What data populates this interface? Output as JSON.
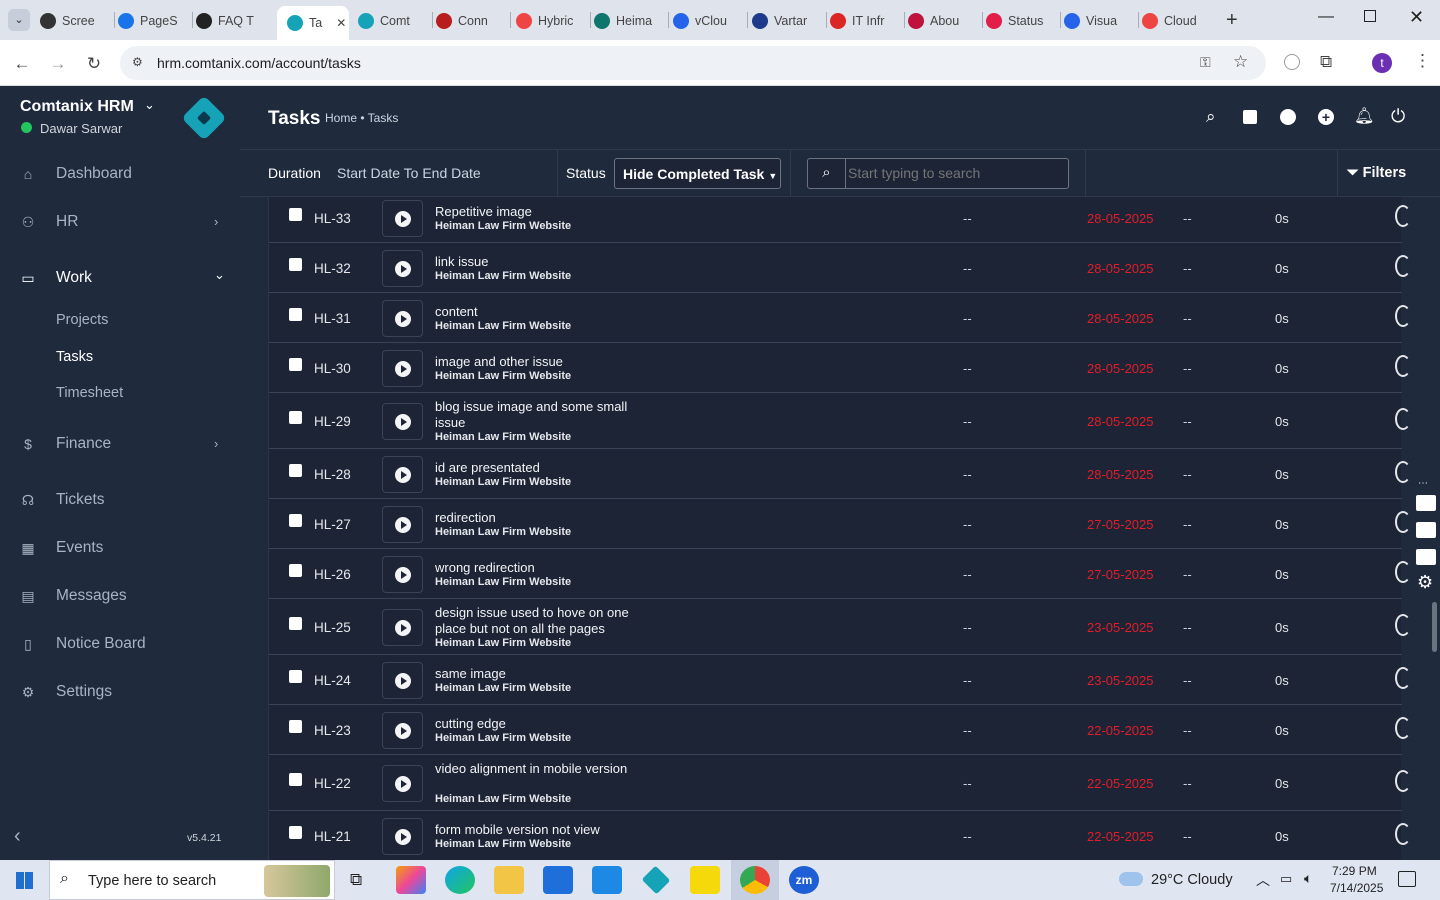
{
  "browser": {
    "tabs": [
      "Scree",
      "PageS",
      "FAQ T",
      "Ta",
      "Comt",
      "Conn",
      "Hybric",
      "Heima",
      "vClou",
      "Vartar",
      "IT Infr",
      "Abou",
      "Status",
      "Visua",
      "Cloud"
    ],
    "url": "hrm.comtanix.com/account/tasks",
    "profile_initial": "t"
  },
  "sidebar": {
    "company": "Comtanix HRM",
    "user": "Dawar Sarwar",
    "items": [
      {
        "label": "Dashboard"
      },
      {
        "label": "HR"
      },
      {
        "label": "Work"
      },
      {
        "label": "Finance"
      },
      {
        "label": "Tickets"
      },
      {
        "label": "Events"
      },
      {
        "label": "Messages"
      },
      {
        "label": "Notice Board"
      },
      {
        "label": "Settings"
      }
    ],
    "sub_items": [
      "Projects",
      "Tasks",
      "Timesheet"
    ],
    "version": "v5.4.21"
  },
  "header": {
    "title": "Tasks",
    "breadcrumb": "Home • Tasks"
  },
  "filters": {
    "duration_label": "Duration",
    "duration_value": "Start Date To End Date",
    "status_label": "Status",
    "status_value": "Hide Completed Task",
    "search_placeholder": "Start typing to search",
    "filters_label": "Filters"
  },
  "tasks": [
    {
      "id": "HL-33",
      "name": "Repetitive image",
      "project": "Heiman Law Firm Website",
      "col1": "--",
      "date": "28-05-2025",
      "col2": "--",
      "time": "0s"
    },
    {
      "id": "HL-32",
      "name": "link issue",
      "project": "Heiman Law Firm Website",
      "col1": "--",
      "date": "28-05-2025",
      "col2": "--",
      "time": "0s"
    },
    {
      "id": "HL-31",
      "name": "content",
      "project": "Heiman Law Firm Website",
      "col1": "--",
      "date": "28-05-2025",
      "col2": "--",
      "time": "0s"
    },
    {
      "id": "HL-30",
      "name": "image and other issue",
      "project": "Heiman Law Firm Website",
      "col1": "--",
      "date": "28-05-2025",
      "col2": "--",
      "time": "0s"
    },
    {
      "id": "HL-29",
      "name": "blog issue image and some small issue",
      "project": "Heiman Law Firm Website",
      "col1": "--",
      "date": "28-05-2025",
      "col2": "--",
      "time": "0s"
    },
    {
      "id": "HL-28",
      "name": "id are presentated",
      "project": "Heiman Law Firm Website",
      "col1": "--",
      "date": "28-05-2025",
      "col2": "--",
      "time": "0s"
    },
    {
      "id": "HL-27",
      "name": "redirection",
      "project": "Heiman Law Firm Website",
      "col1": "--",
      "date": "27-05-2025",
      "col2": "--",
      "time": "0s"
    },
    {
      "id": "HL-26",
      "name": "wrong redirection",
      "project": "Heiman Law Firm Website",
      "col1": "--",
      "date": "27-05-2025",
      "col2": "--",
      "time": "0s"
    },
    {
      "id": "HL-25",
      "name": "design issue used to hove on one place but not on all the pages",
      "project": "Heiman Law Firm Website",
      "col1": "--",
      "date": "23-05-2025",
      "col2": "--",
      "time": "0s"
    },
    {
      "id": "HL-24",
      "name": "same image",
      "project": "Heiman Law Firm Website",
      "col1": "--",
      "date": "23-05-2025",
      "col2": "--",
      "time": "0s"
    },
    {
      "id": "HL-23",
      "name": "cutting edge",
      "project": "Heiman Law Firm Website",
      "col1": "--",
      "date": "22-05-2025",
      "col2": "--",
      "time": "0s"
    },
    {
      "id": "HL-22",
      "name": "video alignment in mobile version",
      "project": "Heiman Law Firm Website",
      "col1": "--",
      "date": "22-05-2025",
      "col2": "--",
      "time": "0s"
    },
    {
      "id": "HL-21",
      "name": "form mobile version not view",
      "project": "Heiman Law Firm Website",
      "col1": "--",
      "date": "22-05-2025",
      "col2": "--",
      "time": "0s"
    }
  ],
  "taskbar": {
    "search_placeholder": "Type here to search",
    "weather": "29°C  Cloudy",
    "time": "7:29 PM",
    "date": "7/14/2025"
  },
  "colors": {
    "sidebar": "#1f2a3d",
    "accent": "#16a3b8",
    "date_red": "#e11d2a"
  }
}
